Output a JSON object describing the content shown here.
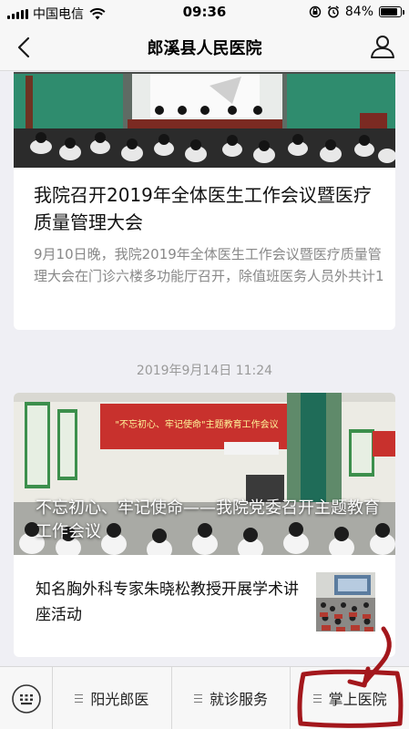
{
  "status_bar": {
    "carrier": "中国电信",
    "time": "09:36",
    "battery": "84%",
    "battery_level": 0.84
  },
  "nav": {
    "title": "郎溪县人民医院",
    "back_icon": "chevron-left-icon",
    "user_icon": "user-icon"
  },
  "articles": [
    {
      "title": "我院召开2019年全体医生工作会议暨医疗质量管理大会",
      "summary": "9月10日晚，我院2019年全体医生工作会议暨医疗质量管理大会在门诊六楼多功能厅召开，除值班医务人员外共计1"
    }
  ],
  "timestamp": "2019年9月14日 11:24",
  "group": {
    "banner_sign": "\"不忘初心、牢记使命\"主题教育工作会议",
    "main_title": "不忘初心、牢记使命——我院党委召开主题教育工作会议",
    "sub_article_title": "知名胸外科专家朱晓松教授开展学术讲座活动"
  },
  "bottom_menu": {
    "keyboard_icon": "keyboard-icon",
    "items": [
      {
        "label": "阳光郎医"
      },
      {
        "label": "就诊服务"
      },
      {
        "label": "掌上医院"
      }
    ]
  },
  "colors": {
    "annotation": "#a3171c",
    "banner_red": "#c8312d"
  }
}
